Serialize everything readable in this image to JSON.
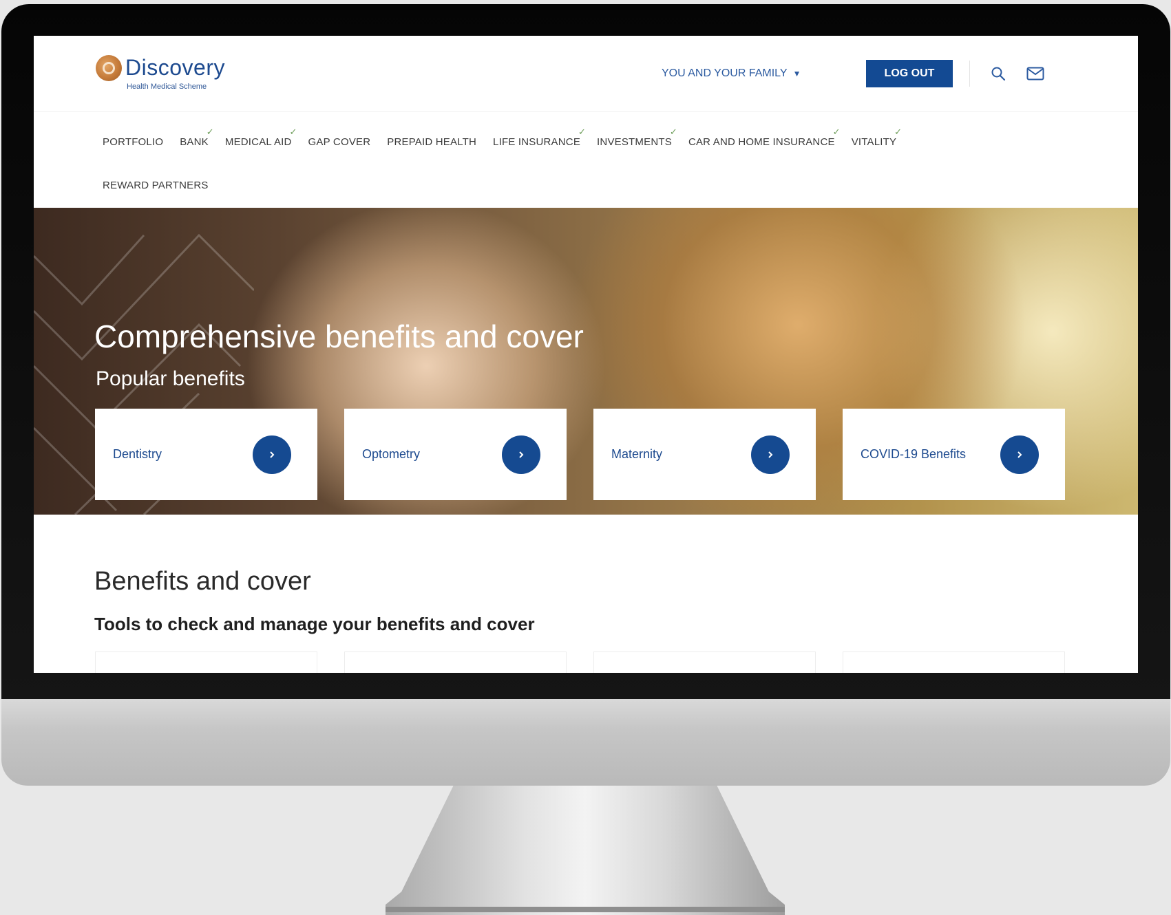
{
  "brand": {
    "name": "Discovery",
    "subtitle": "Health Medical Scheme"
  },
  "header": {
    "family_menu_label": "YOU AND YOUR FAMILY",
    "logout_label": "LOG OUT"
  },
  "nav": {
    "items": [
      {
        "label": "PORTFOLIO",
        "checked": false
      },
      {
        "label": "BANK",
        "checked": true
      },
      {
        "label": "MEDICAL AID",
        "checked": true
      },
      {
        "label": "GAP COVER",
        "checked": false
      },
      {
        "label": "PREPAID HEALTH",
        "checked": false
      },
      {
        "label": "LIFE INSURANCE",
        "checked": true
      },
      {
        "label": "INVESTMENTS",
        "checked": true
      },
      {
        "label": "CAR AND HOME INSURANCE",
        "checked": true
      },
      {
        "label": "VITALITY",
        "checked": true
      }
    ],
    "second_row": "REWARD PARTNERS"
  },
  "hero": {
    "title": "Comprehensive benefits and cover",
    "subtitle": "Popular benefits",
    "cards": [
      {
        "label": "Dentistry"
      },
      {
        "label": "Optometry"
      },
      {
        "label": "Maternity"
      },
      {
        "label": "COVID-19 Benefits"
      }
    ]
  },
  "benefits_section": {
    "title": "Benefits and cover",
    "subtitle": "Tools to check and manage your benefits and cover"
  },
  "colors": {
    "brand_blue": "#134a93",
    "logo_copper": "#c57b3a",
    "check_green": "#6e9e5a"
  },
  "icons": {
    "search": "search-icon",
    "mail": "mail-icon",
    "arrow": "chevron-right-icon"
  }
}
